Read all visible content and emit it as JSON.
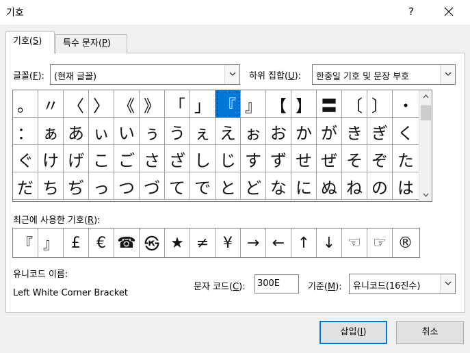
{
  "window": {
    "title": "기호",
    "help_label": "?"
  },
  "tabs": [
    {
      "label": "기호(",
      "key": "S",
      "suffix": ")"
    },
    {
      "label": "특수 문자(",
      "key": "P",
      "suffix": ")"
    }
  ],
  "font_selector": {
    "label": "글꼴(",
    "key": "F",
    "suffix": "):",
    "value": "(현재 글꼴)"
  },
  "subset_selector": {
    "label": "하위 집합(",
    "key": "U",
    "suffix": "):",
    "value": "한중일 기호 및 문장 부호"
  },
  "symbol_grid": {
    "selected_index": 8,
    "rows": [
      [
        "。",
        "〃",
        "〈",
        "〉",
        "《",
        "》",
        "「",
        "」",
        "『",
        "』",
        "【",
        "】",
        "〓",
        "〔",
        "〕",
        "・"
      ],
      [
        "：",
        "ぁ",
        "あ",
        "ぃ",
        "い",
        "ぅ",
        "う",
        "ぇ",
        "え",
        "ぉ",
        "お",
        "か",
        "が",
        "き",
        "ぎ",
        "く"
      ],
      [
        "ぐ",
        "け",
        "げ",
        "こ",
        "ご",
        "さ",
        "ざ",
        "し",
        "じ",
        "す",
        "ず",
        "せ",
        "ぜ",
        "そ",
        "ぞ",
        "た"
      ],
      [
        "だ",
        "ち",
        "ぢ",
        "っ",
        "つ",
        "づ",
        "て",
        "で",
        "と",
        "ど",
        "な",
        "に",
        "ぬ",
        "ね",
        "の",
        "は"
      ]
    ]
  },
  "recent": {
    "label": "최근에 사용한 기호(",
    "key": "R",
    "suffix": "):",
    "symbols": [
      "『",
      "』",
      "£",
      "€",
      "☎",
      "㉿",
      "★",
      "≠",
      "¥",
      "→",
      "←",
      "↑",
      "↓",
      "☜",
      "☞",
      "®"
    ]
  },
  "unicode_name": {
    "label": "유니코드 이름:",
    "value": "Left White Corner Bracket"
  },
  "char_code": {
    "label": "문자 코드(",
    "key": "C",
    "suffix": "):",
    "value": "300E"
  },
  "basis": {
    "label": "기준(",
    "key": "M",
    "suffix": "):",
    "value": "유니코드(16진수)"
  },
  "buttons": {
    "insert": {
      "label": "삽입(",
      "key": "I",
      "suffix": ")"
    },
    "cancel": {
      "label": "취소"
    }
  }
}
